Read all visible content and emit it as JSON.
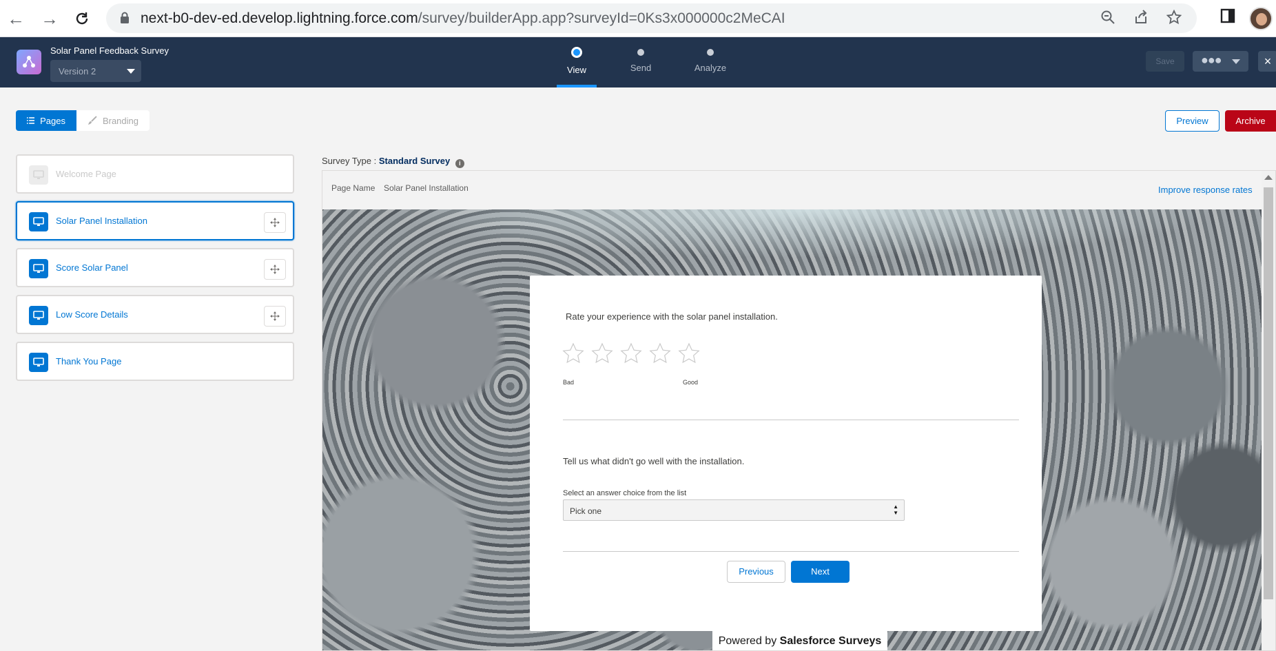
{
  "browser": {
    "url_host": "next-b0-dev-ed.develop.lightning.force.com",
    "url_path": "/survey/builderApp.app?surveyId=0Ks3x000000c2MeCAI"
  },
  "header": {
    "survey_title": "Solar Panel Feedback Survey",
    "version": "Version 2",
    "steps": [
      {
        "label": "View"
      },
      {
        "label": "Send"
      },
      {
        "label": "Analyze"
      }
    ],
    "save_label": "Save",
    "more_dots": "●●●",
    "close_label": "×"
  },
  "toolbar": {
    "pages_label": "Pages",
    "branding_label": "Branding",
    "preview_label": "Preview",
    "archive_label": "Archive"
  },
  "pages": [
    {
      "label": "Welcome Page"
    },
    {
      "label": "Solar Panel Installation"
    },
    {
      "label": "Score Solar Panel"
    },
    {
      "label": "Low Score Details"
    },
    {
      "label": "Thank You Page"
    }
  ],
  "canvas": {
    "survey_type_label": "Survey Type :",
    "survey_type_value": "Standard Survey",
    "page_name_label": "Page Name",
    "page_name_value": "Solar Panel Installation",
    "improve_link": "Improve response rates",
    "question1": "Rate your experience with the solar panel installation.",
    "rating_low": "Bad",
    "rating_high": "Good",
    "question2": "Tell us what didn't go well with the installation.",
    "select_label": "Select an answer choice from the list",
    "select_value": "Pick one",
    "previous_label": "Previous",
    "next_label": "Next",
    "powered_prefix": "Powered by ",
    "powered_brand": "Salesforce Surveys"
  },
  "colors": {
    "brand_blue": "#0176d3",
    "header_navy": "#22344e",
    "archive_red": "#ba0517"
  }
}
